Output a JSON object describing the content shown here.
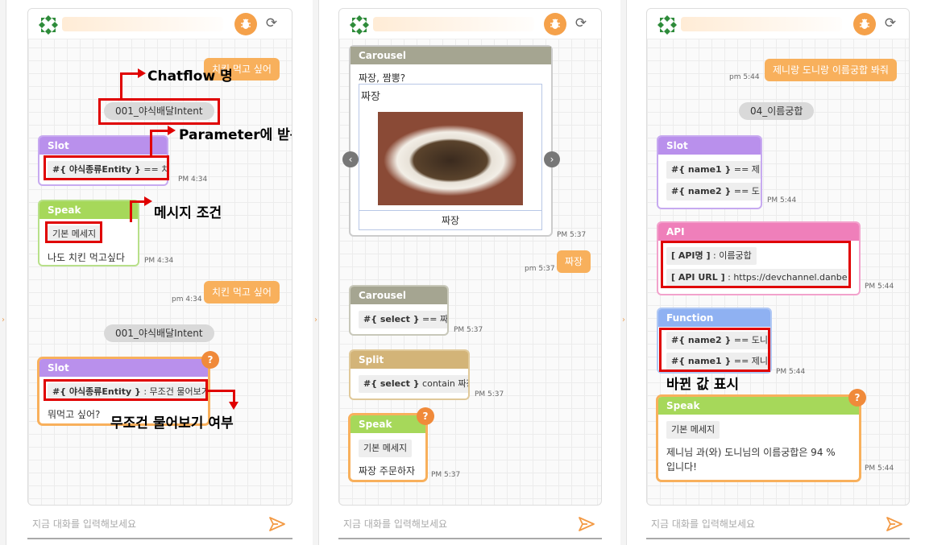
{
  "colors": {
    "user_bubble": "#f8b05c",
    "slot": "#b990ec",
    "speak": "#a6d85a",
    "carousel": "#a5a591",
    "split": "#d3b478",
    "api": "#ef7fba",
    "function": "#8fb1f2",
    "annotation": "#e00000"
  },
  "header": {
    "bug_icon": "bug-icon",
    "refresh_icon": "refresh-icon"
  },
  "input": {
    "placeholder": "지금 대화를 입력해보세요"
  },
  "p1": {
    "user1": "치킨 먹고 싶어",
    "intent1": "001_야식배달Intent",
    "slot1": {
      "title": "Slot",
      "expr_var": "#{ 야식종류Entity }",
      "expr_op": " == 치킨",
      "time": "PM 4:34"
    },
    "speak1": {
      "title": "Speak",
      "tag": "기본 메세지",
      "text": "나도 치킨 먹고싶다",
      "time": "PM 4:34"
    },
    "user2": "치킨 먹고 싶어",
    "user2_time": "pm 4:34",
    "intent2": "001_야식배달Intent",
    "slot2": {
      "title": "Slot",
      "expr_var": "#{ 야식종류Entity }",
      "expr_op": " : 무조건 물어보기",
      "text": "뭐먹고 싶어?",
      "badge": "?"
    },
    "ann_chatflow": "Chatflow 명",
    "ann_param": "Parameter에 받은 값",
    "ann_msg": "메시지 조건",
    "ann_always": "무조건 물어보기 여부"
  },
  "p2": {
    "carousel": {
      "title": "Carousel",
      "question": "짜장, 짬뽕?",
      "item_title": "짜장",
      "button": "짜장",
      "time": "PM 5:37"
    },
    "user": "짜장",
    "user_time": "pm 5:37",
    "c2": {
      "title": "Carousel",
      "expr_var": "#{ select }",
      "expr_op": " == 짜장",
      "time": "PM 5:37"
    },
    "split": {
      "title": "Split",
      "expr_var": "#{ select }",
      "expr_op": " contain 짜장",
      "time": "PM 5:37"
    },
    "speak": {
      "title": "Speak",
      "tag": "기본 메세지",
      "text": "짜장 주문하자",
      "time": "PM 5:37",
      "badge": "?"
    }
  },
  "p3": {
    "user": "제니랑 도니랑 이름궁합 봐줘",
    "user_time": "pm 5:44",
    "intent": "04_이름궁합",
    "slot": {
      "title": "Slot",
      "r1_var": "#{ name1 }",
      "r1_op": " == 제니",
      "r2_var": "#{ name2 }",
      "r2_op": " == 도니",
      "time": "PM 5:44"
    },
    "api": {
      "title": "API",
      "r1_var": "[ API명 ]",
      "r1_op": " : 이름궁합",
      "r2_var": "[ API URL ]",
      "r2_op": " : https://devchannel.danbee....",
      "time": "PM 5:44"
    },
    "func": {
      "title": "Function",
      "r1_var": "#{ name2 }",
      "r1_op": " == 도니님",
      "r2_var": "#{ name1 }",
      "r2_op": " == 제니님",
      "time": "PM 5:44"
    },
    "ann_changed": "바뀐 값 표시",
    "speak": {
      "title": "Speak",
      "tag": "기본 메세지",
      "line1": "제니님 과(와) 도니님의 이름궁합은 94 %",
      "line2": "입니다!",
      "time": "PM 5:44",
      "badge": "?"
    }
  }
}
